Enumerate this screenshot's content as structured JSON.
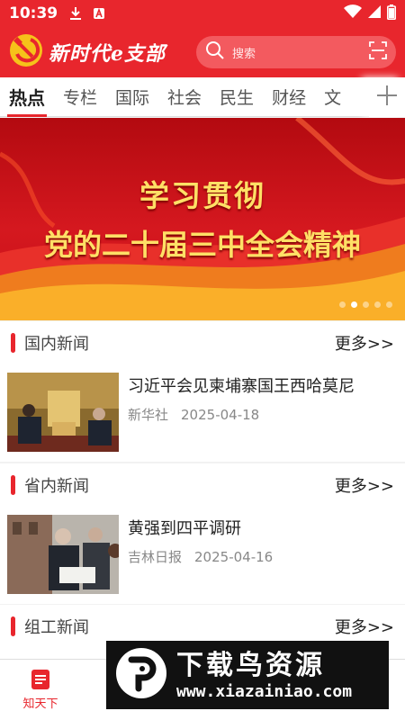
{
  "status_bar": {
    "time": "10:39"
  },
  "header": {
    "app_title": "新时代e支部",
    "search_placeholder": "搜索"
  },
  "tabs": [
    {
      "label": "热点",
      "active": true
    },
    {
      "label": "专栏"
    },
    {
      "label": "国际"
    },
    {
      "label": "社会"
    },
    {
      "label": "民生"
    },
    {
      "label": "财经"
    },
    {
      "label": "文"
    }
  ],
  "banner": {
    "line1": "学习贯彻",
    "line2": "党的二十届三中全会精神",
    "slide_count": 5,
    "active_slide": 1
  },
  "sections": [
    {
      "title": "国内新闻",
      "more": "更多>>",
      "item": {
        "headline": "习近平会见柬埔寨国王西哈莫尼",
        "source": "新华社",
        "date": "2025-04-18"
      }
    },
    {
      "title": "省内新闻",
      "more": "更多>>",
      "item": {
        "headline": "黄强到四平调研",
        "source": "吉林日报",
        "date": "2025-04-16"
      }
    },
    {
      "title": "组工新闻",
      "more": "更多>>"
    }
  ],
  "bottom_nav": [
    {
      "label": "知天下",
      "active": true
    },
    {
      "label": ""
    },
    {
      "label": ""
    },
    {
      "label": ""
    },
    {
      "label": ""
    }
  ],
  "watermark": {
    "title": "下载鸟资源",
    "url": "www.xiazainiao.com"
  },
  "colors": {
    "brand_red": "#e8262d",
    "banner_text": "#ffe066"
  }
}
